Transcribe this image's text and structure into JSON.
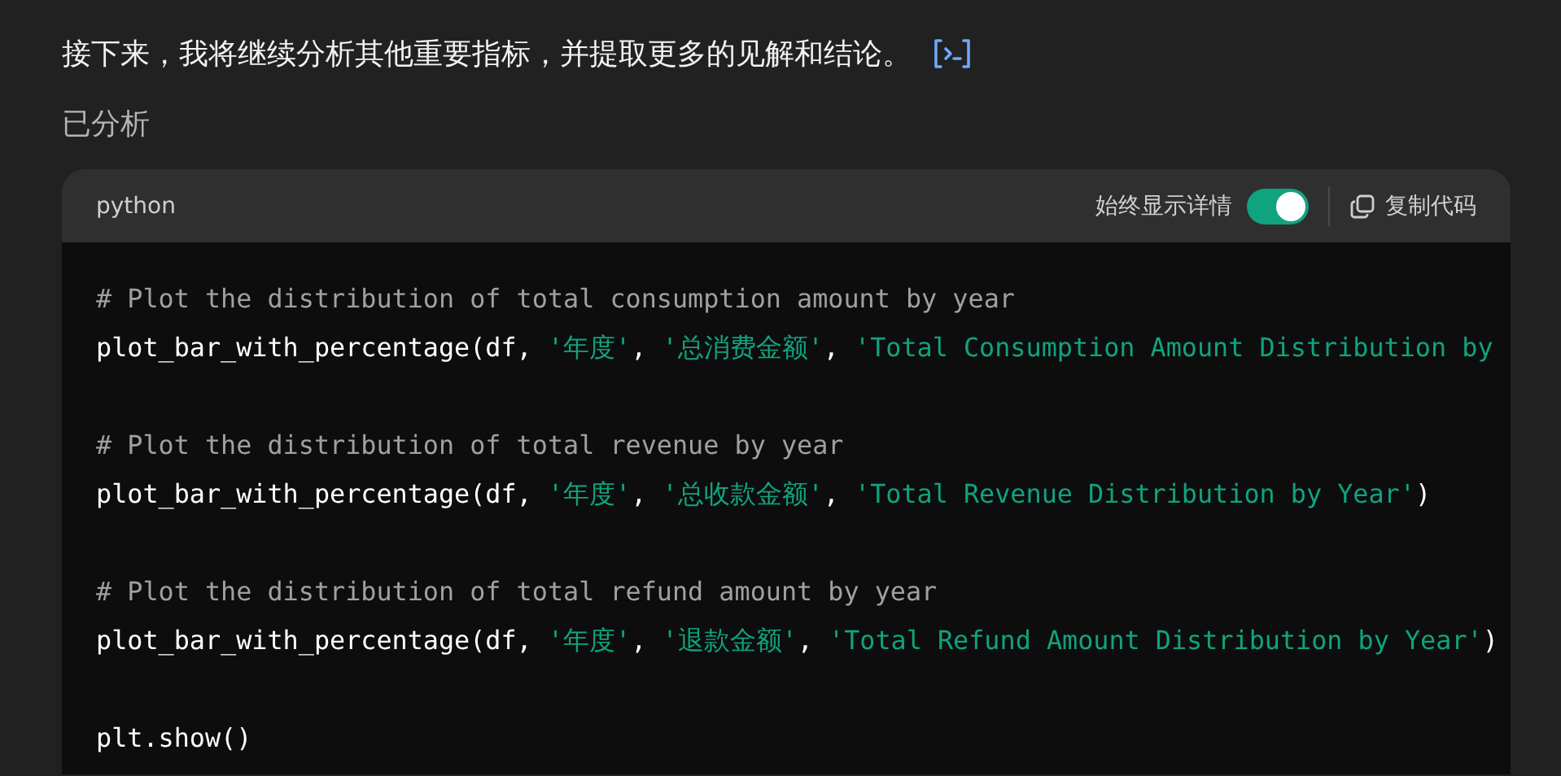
{
  "message": {
    "text": "接下来，我将继续分析其他重要指标，并提取更多的见解和结论。"
  },
  "status": "已分析",
  "code_block": {
    "language": "python",
    "toggle": {
      "label": "始终显示详情",
      "on": true
    },
    "copy_label": "复制代码",
    "blocks": [
      {
        "lines": [
          {
            "tokens": [
              {
                "kind": "comment",
                "text": "# Plot the distribution of total consumption amount by year"
              }
            ]
          },
          {
            "tokens": [
              {
                "kind": "plain",
                "text": "plot_bar_with_percentage(df, "
              },
              {
                "kind": "string",
                "text": "'年度'"
              },
              {
                "kind": "plain",
                "text": ", "
              },
              {
                "kind": "string",
                "text": "'总消费金额'"
              },
              {
                "kind": "plain",
                "text": ", "
              },
              {
                "kind": "string",
                "text": "'Total Consumption Amount Distribution by"
              }
            ]
          }
        ]
      },
      {
        "lines": [
          {
            "tokens": [
              {
                "kind": "comment",
                "text": "# Plot the distribution of total revenue by year"
              }
            ]
          },
          {
            "tokens": [
              {
                "kind": "plain",
                "text": "plot_bar_with_percentage(df, "
              },
              {
                "kind": "string",
                "text": "'年度'"
              },
              {
                "kind": "plain",
                "text": ", "
              },
              {
                "kind": "string",
                "text": "'总收款金额'"
              },
              {
                "kind": "plain",
                "text": ", "
              },
              {
                "kind": "string",
                "text": "'Total Revenue Distribution by Year'"
              },
              {
                "kind": "plain",
                "text": ")"
              }
            ]
          }
        ]
      },
      {
        "lines": [
          {
            "tokens": [
              {
                "kind": "comment",
                "text": "# Plot the distribution of total refund amount by year"
              }
            ]
          },
          {
            "tokens": [
              {
                "kind": "plain",
                "text": "plot_bar_with_percentage(df, "
              },
              {
                "kind": "string",
                "text": "'年度'"
              },
              {
                "kind": "plain",
                "text": ", "
              },
              {
                "kind": "string",
                "text": "'退款金额'"
              },
              {
                "kind": "plain",
                "text": ", "
              },
              {
                "kind": "string",
                "text": "'Total Refund Amount Distribution by Year'"
              },
              {
                "kind": "plain",
                "text": ")"
              }
            ]
          }
        ]
      },
      {
        "lines": [
          {
            "tokens": [
              {
                "kind": "plain",
                "text": "plt.show()"
              }
            ]
          }
        ]
      }
    ]
  }
}
